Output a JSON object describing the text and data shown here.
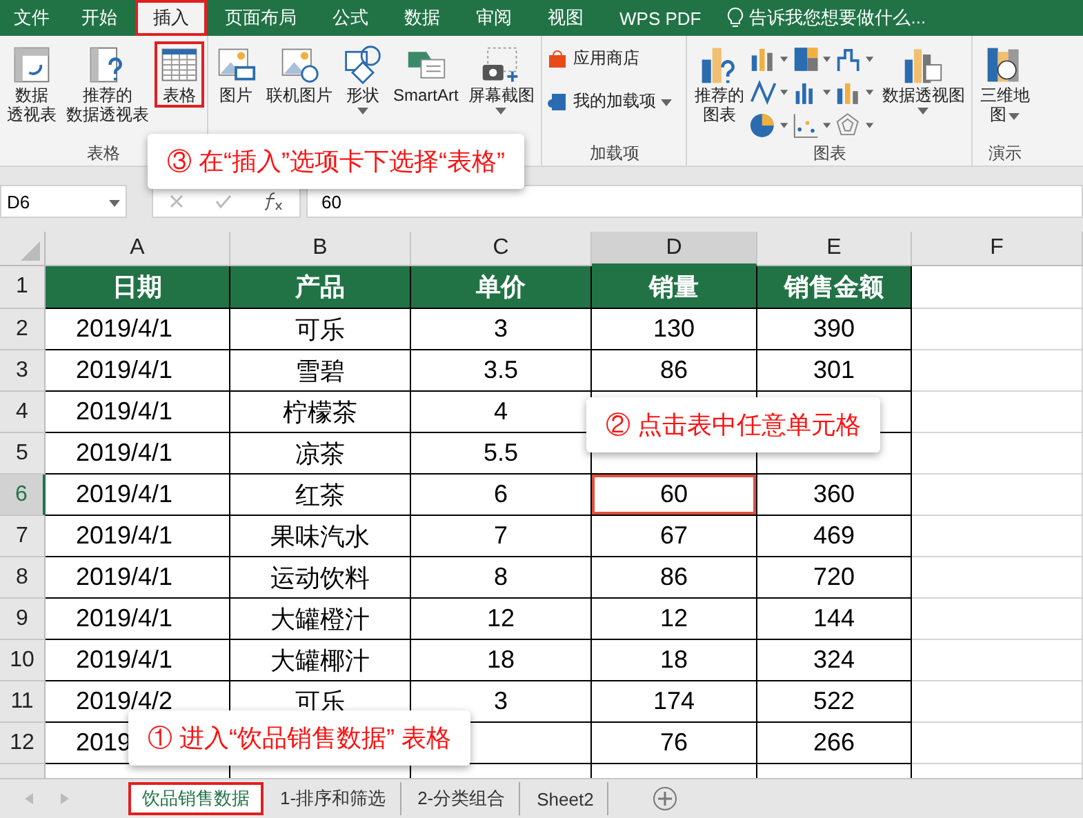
{
  "menu_tabs": [
    {
      "label": "文件",
      "selected": false
    },
    {
      "label": "开始",
      "selected": false
    },
    {
      "label": "插入",
      "selected": true
    },
    {
      "label": "页面布局",
      "selected": false
    },
    {
      "label": "公式",
      "selected": false
    },
    {
      "label": "数据",
      "selected": false
    },
    {
      "label": "审阅",
      "selected": false
    },
    {
      "label": "视图",
      "selected": false
    },
    {
      "label": "WPS PDF",
      "selected": false
    }
  ],
  "tell_me": "告诉我您想要做什么...",
  "ribbon_groups": [
    {
      "label": "表格",
      "buttons": [
        {
          "lines": [
            "数据",
            "透视表"
          ],
          "highlighted": false,
          "dropdown": false
        },
        {
          "lines": [
            "推荐的",
            "数据透视表"
          ],
          "highlighted": false,
          "dropdown": false
        },
        {
          "lines": [
            "表格"
          ],
          "highlighted": true,
          "dropdown": false
        }
      ]
    },
    {
      "buttons": [
        {
          "lines": [
            "图片"
          ],
          "highlighted": false,
          "dropdown": false
        },
        {
          "lines": [
            "联机图片"
          ],
          "highlighted": false,
          "dropdown": false
        },
        {
          "lines": [
            "形状"
          ],
          "highlighted": false,
          "dropdown": true
        },
        {
          "lines": [
            "SmartArt"
          ],
          "highlighted": false,
          "dropdown": false
        },
        {
          "lines": [
            "屏幕截图"
          ],
          "highlighted": false,
          "dropdown": true
        }
      ]
    }
  ],
  "addins": {
    "label": "加载项",
    "items": [
      {
        "label": "应用商店",
        "dropdown": false
      },
      {
        "label": "我的加载项",
        "dropdown": true
      }
    ]
  },
  "charts": {
    "label": "图表",
    "recommended": [
      "推荐的",
      "图表"
    ],
    "pivot_chart": "数据透视图"
  },
  "tours": {
    "label": "演示",
    "map": [
      "三维地",
      "图"
    ]
  },
  "formula_bar": {
    "name_box": "D6",
    "value": "60"
  },
  "columns": [
    {
      "label": "A",
      "selected": false
    },
    {
      "label": "B",
      "selected": false
    },
    {
      "label": "C",
      "selected": false
    },
    {
      "label": "D",
      "selected": true
    },
    {
      "label": "E",
      "selected": false
    },
    {
      "label": "F",
      "selected": false
    }
  ],
  "rows": [
    {
      "number": "1",
      "selected": false,
      "kind": "header",
      "cells": [
        "日期",
        "产品",
        "单价",
        "销量",
        "销售金额"
      ]
    },
    {
      "number": "2",
      "selected": false,
      "kind": "data",
      "cells": [
        "2019/4/1",
        "可乐",
        "3",
        "130",
        "390"
      ]
    },
    {
      "number": "3",
      "selected": false,
      "kind": "data",
      "cells": [
        "2019/4/1",
        "雪碧",
        "3.5",
        "86",
        "301"
      ]
    },
    {
      "number": "4",
      "selected": false,
      "kind": "data",
      "cells": [
        "2019/4/1",
        "柠檬茶",
        "4",
        "",
        ""
      ]
    },
    {
      "number": "5",
      "selected": false,
      "kind": "data",
      "cells": [
        "2019/4/1",
        "凉茶",
        "5.5",
        "",
        ""
      ]
    },
    {
      "number": "6",
      "selected": true,
      "kind": "data",
      "cells": [
        "2019/4/1",
        "红茶",
        "6",
        "60",
        "360"
      ]
    },
    {
      "number": "7",
      "selected": false,
      "kind": "data",
      "cells": [
        "2019/4/1",
        "果味汽水",
        "7",
        "67",
        "469"
      ]
    },
    {
      "number": "8",
      "selected": false,
      "kind": "data",
      "cells": [
        "2019/4/1",
        "运动饮料",
        "8",
        "86",
        "720"
      ]
    },
    {
      "number": "9",
      "selected": false,
      "kind": "data",
      "cells": [
        "2019/4/1",
        "大罐橙汁",
        "12",
        "12",
        "144"
      ]
    },
    {
      "number": "10",
      "selected": false,
      "kind": "data",
      "cells": [
        "2019/4/1",
        "大罐椰汁",
        "18",
        "18",
        "324"
      ]
    },
    {
      "number": "11",
      "selected": false,
      "kind": "data",
      "cells": [
        "2019/4/2",
        "可乐",
        "3",
        "174",
        "522"
      ]
    },
    {
      "number": "12",
      "selected": false,
      "kind": "data",
      "cells": [
        "2019",
        "",
        "",
        "76",
        "266"
      ]
    }
  ],
  "sheet_tabs": [
    {
      "label": "饮品销售数据",
      "selected": true
    },
    {
      "label": "1-排序和筛选",
      "selected": false
    },
    {
      "label": "2-分类组合",
      "selected": false
    },
    {
      "label": "Sheet2",
      "selected": false
    }
  ],
  "callouts": [
    {
      "text": "③ 在“插入”选项卡下选择“表格”"
    },
    {
      "text": "② 点击表中任意单元格"
    },
    {
      "text": "① 进入“饮品销售数据” 表格"
    }
  ]
}
